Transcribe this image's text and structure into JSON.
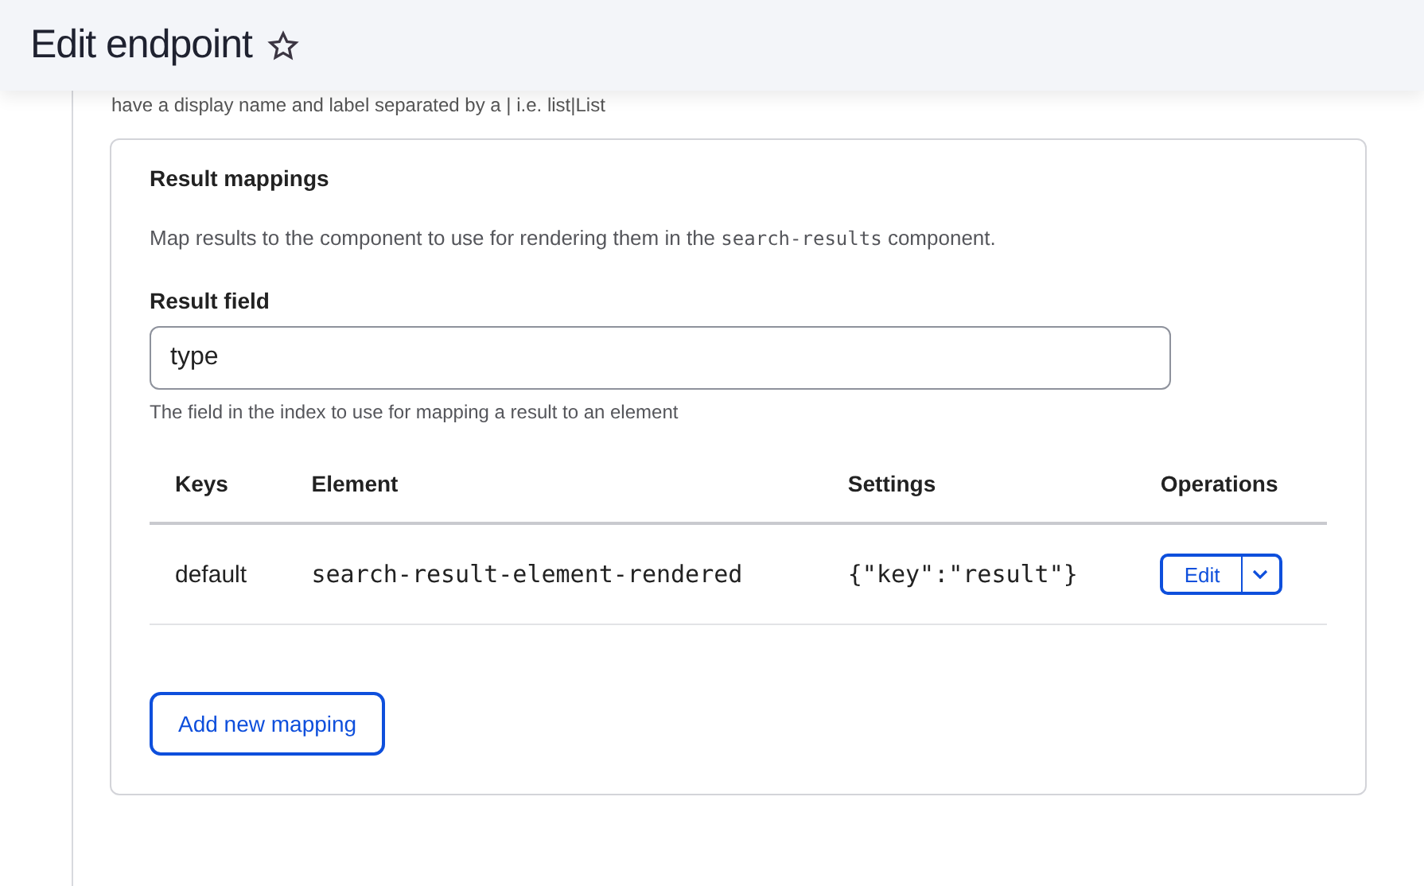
{
  "header": {
    "title": "Edit endpoint",
    "favorite": false
  },
  "previous_hint": "have a display name and label separated by a | i.e. list|List",
  "result_mappings": {
    "title": "Result mappings",
    "description": [
      {
        "kind": "text",
        "text": "Map results to the component to use for rendering them in the"
      },
      {
        "kind": "code",
        "text": "search-results"
      },
      {
        "kind": "text",
        "text": "component."
      }
    ],
    "field": {
      "label": "Result field",
      "value": "type",
      "help": "The field in the index to use for mapping a result to an element"
    },
    "table": {
      "columns": [
        "Keys",
        "Element",
        "Settings",
        "Operations"
      ],
      "rows": [
        {
          "key": "default",
          "element": "search-result-element-rendered",
          "settings": "{\"key\":\"result\"}",
          "operation": "Edit"
        }
      ]
    },
    "add_button": "Add new mapping"
  }
}
